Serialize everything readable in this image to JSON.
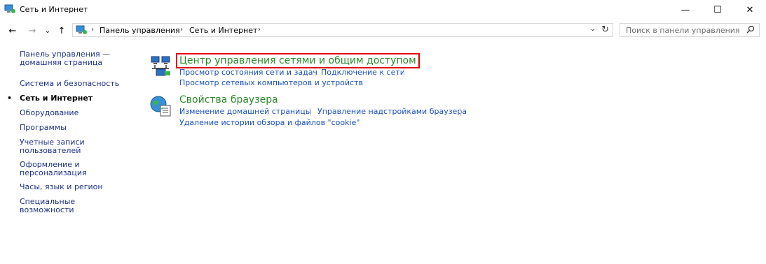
{
  "window": {
    "title": "Сеть и Интернет",
    "minimize": "—",
    "maximize": "☐",
    "close": "✕"
  },
  "nav": {
    "back": "←",
    "forward": "→",
    "recent": "⌄",
    "up": "↑"
  },
  "address": {
    "crumbs": [
      "Панель управления",
      "Сеть и Интернет"
    ],
    "separator": "›",
    "dropdown": "⌄",
    "refresh": "↻"
  },
  "search": {
    "placeholder": "Поиск в панели управления"
  },
  "sidebar": {
    "items": [
      {
        "label": "Панель управления —\nдомашняя страница"
      },
      {
        "label": "Система и безопасность"
      },
      {
        "label": "Сеть и Интернет",
        "current": true
      },
      {
        "label": "Оборудование"
      },
      {
        "label": "Программы"
      },
      {
        "label": "Учетные записи\nпользователей"
      },
      {
        "label": "Оформление и\nперсонализация"
      },
      {
        "label": "Часы, язык и регион"
      },
      {
        "label": "Специальные возможности"
      }
    ],
    "bullet": "•"
  },
  "categories": [
    {
      "title": "Центр управления сетями и общим доступом",
      "icon": "network-center-icon",
      "links": [
        "Просмотр состояния сети и задач",
        "Подключение к сети",
        "Просмотр сетевых компьютеров и устройств"
      ]
    },
    {
      "title": "Свойства браузера",
      "icon": "browser-properties-icon",
      "links": [
        "Изменение домашней страницы",
        "Управление надстройками браузера",
        "Удаление истории обзора и файлов \"cookie\""
      ]
    }
  ],
  "colors": {
    "category_title": "#2a8a2a",
    "task_link": "#1c4fbf",
    "sidebar_link": "#1e3287",
    "highlight_box": "#e00000"
  }
}
